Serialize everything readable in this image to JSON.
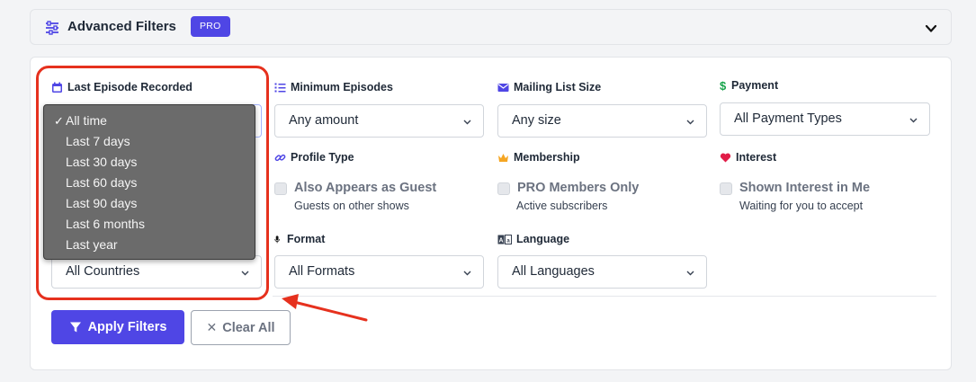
{
  "header": {
    "title": "Advanced Filters",
    "badge": "PRO",
    "accent_color": "#4f46e5"
  },
  "filters": {
    "last_episode": {
      "label": "Last Episode Recorded",
      "icon": "calendar-icon",
      "options": [
        "All time",
        "Last 7 days",
        "Last 30 days",
        "Last 60 days",
        "Last 90 days",
        "Last 6 months",
        "Last year"
      ],
      "selected": "All time"
    },
    "min_episodes": {
      "label": "Minimum Episodes",
      "icon": "list-numbered-icon",
      "value": "Any amount"
    },
    "mailing_list": {
      "label": "Mailing List Size",
      "icon": "envelope-icon",
      "value": "Any size"
    },
    "payment": {
      "label": "Payment",
      "icon": "dollar-icon",
      "value": "All Payment Types"
    },
    "profile_type": {
      "label": "Profile Type",
      "icon": "link-icon",
      "checkbox_label": "Also Appears as Guest",
      "checkbox_sub": "Guests on other shows"
    },
    "membership": {
      "label": "Membership",
      "icon": "crown-icon",
      "checkbox_label": "PRO Members Only",
      "checkbox_sub": "Active subscribers"
    },
    "interest": {
      "label": "Interest",
      "icon": "heart-icon",
      "checkbox_label": "Shown Interest in Me",
      "checkbox_sub": "Waiting for you to accept"
    },
    "country": {
      "value": "All Countries"
    },
    "format": {
      "label": "Format",
      "icon": "microphone-icon",
      "value": "All Formats"
    },
    "language": {
      "label": "Language",
      "icon": "translate-icon",
      "value": "All Languages"
    }
  },
  "actions": {
    "apply": "Apply Filters",
    "clear": "Clear All"
  },
  "annotation_color": "#e6311e"
}
